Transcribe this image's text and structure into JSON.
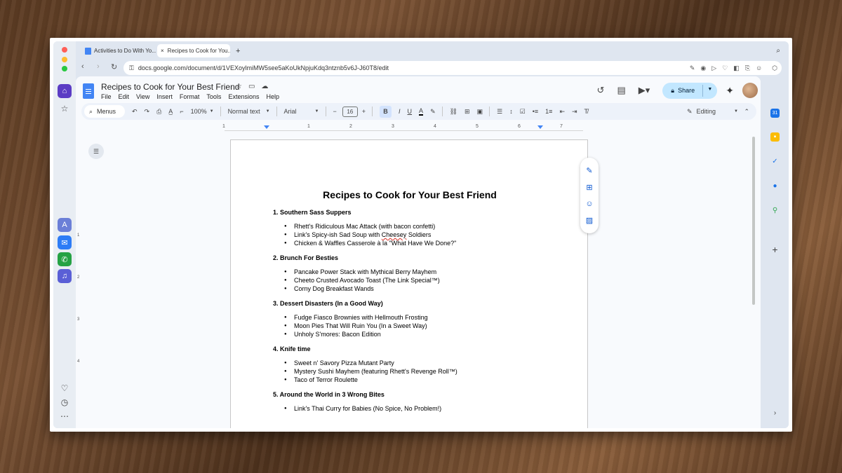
{
  "browser": {
    "tabs": [
      {
        "label": "Activities to Do With Yo..."
      },
      {
        "label": "Recipes to Cook for You..."
      }
    ],
    "new_tab": "+",
    "url": "docs.google.com/document/d/1VEXoylmiMW5see5aKoUkNpjuKdq3ntznb5v6J-J60T8/edit"
  },
  "docs": {
    "title": "Recipes to Cook for Your Best Friend",
    "menu": [
      "File",
      "Edit",
      "View",
      "Insert",
      "Format",
      "Tools",
      "Extensions",
      "Help"
    ],
    "share_label": "Share",
    "toolbar": {
      "menus_label": "Menus",
      "zoom": "100%",
      "style": "Normal text",
      "font": "Arial",
      "font_size": "16",
      "bold": "B",
      "italic": "I",
      "underline": "U",
      "editing": "Editing"
    },
    "ruler_numbers": [
      "1",
      "1",
      "2",
      "3",
      "4",
      "5",
      "6",
      "7"
    ],
    "vruler_numbers": [
      "1",
      "2",
      "3",
      "4"
    ]
  },
  "document": {
    "heading": "Recipes to Cook for Your Best Friend",
    "sections": [
      {
        "title": "1. Southern Sass Suppers",
        "items": [
          "Rhett's Ridiculous Mac Attack (with bacon confetti)",
          "Link's Spicy-ish Sad Soup with Cheesey Soldiers",
          "Chicken & Waffles Casserole à la \"What Have We Done?\""
        ]
      },
      {
        "title": "2. Brunch For Besties",
        "items": [
          "Pancake Power Stack with Mythical Berry Mayhem",
          "Cheeto Crusted Avocado Toast (The Link Special™)",
          "Corny Dog Breakfast Wands"
        ]
      },
      {
        "title": "3. Dessert Disasters (In a Good Way)",
        "items": [
          "Fudge Fiasco Brownies with Hellmouth Frosting",
          "Moon Pies That Will Ruin You (In a Sweet Way)",
          "Unholy S'mores: Bacon Edition"
        ]
      },
      {
        "title": "4. Knife time",
        "items": [
          "Sweet n' Savory Pizza Mutant Party",
          "Mystery Sushi Mayhem (featuring Rhett's Revenge Roll™)",
          "Taco of Terror Roulette"
        ]
      },
      {
        "title": "5. Around the World in 3 Wrong Bites",
        "items": [
          "Link's Thai Curry for Babies (No Spice, No Problem!)"
        ]
      }
    ]
  },
  "colors": {
    "accent": "#0b57d0",
    "share_bg": "#c2e7ff",
    "docs_blue": "#4285f4"
  }
}
